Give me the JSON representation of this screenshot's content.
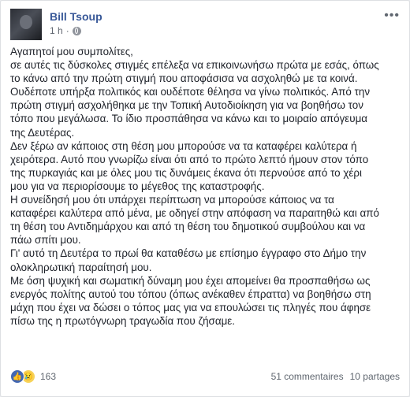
{
  "post": {
    "author": "Bill Tsoup",
    "time": "1 h",
    "separator": "·",
    "lines": [
      "Αγαπητοί μου συμπολίτες,",
      "σε αυτές τις δύσκολες στιγμές επέλεξα να επικοινωνήσω πρώτα με εσάς, όπως",
      "το κάνω από την πρώτη στιγμή που αποφάσισα να ασχοληθώ με τα κοινά.",
      "Ουδέποτε υπήρξα πολιτικός και ουδέποτε θέλησα να γίνω πολιτικός. Από την",
      "πρώτη στιγμή ασχολήθηκα με την Τοπική Αυτοδιοίκηση για να βοηθήσω τον",
      "τόπο που μεγάλωσα. Το ίδιο προσπάθησα να κάνω και το μοιραίο απόγευμα",
      "της Δευτέρας.",
      "Δεν ξέρω αν κάποιος στη θέση μου μπορούσε να τα καταφέρει καλύτερα ή",
      "χειρότερα. Αυτό που γνωρίζω είναι ότι από το πρώτο λεπτό ήμουν στον τόπο",
      "της πυρκαγιάς και με όλες μου τις δυνάμεις έκανα ότι περνούσε από το χέρι",
      "μου για να περιορίσουμε το μέγεθος της καταστροφής.",
      "Η συνείδησή μου ότι υπάρχει περίπτωση να μπορούσε κάποιος να τα",
      "καταφέρει καλύτερα από μένα, με οδηγεί στην απόφαση να παραιτηθώ και από",
      "τη θέση του Αντιδημάρχου και από τη θέση του δημοτικού συμβούλου και να",
      "πάω σπίτι μου.",
      "Γι' αυτό τη Δευτέρα το πρωί θα καταθέσω με επίσημο έγγραφο στο Δήμο την",
      "ολοκληρωτική παραίτησή μου.",
      "Με όση ψυχική και σωματική δύναμη μου έχει απομείνει θα προσπαθήσω ως",
      "ενεργός πολίτης αυτού του τόπου (όπως ανέκαθεν έπραττα) να βοηθήσω στη",
      "μάχη που έχει να δώσει ο τόπος μας για να επουλώσει τις πληγές που άφησε",
      "πίσω της η πρωτόγνωρη τραγωδία που ζήσαμε."
    ]
  },
  "icons": {
    "globe": "globe-icon",
    "more": "more-options-icon",
    "like": "like-reaction-icon",
    "sad": "sad-reaction-icon"
  },
  "footer": {
    "reaction_count": "163",
    "comments": "51 commentaires",
    "shares": "10 partages"
  },
  "colors": {
    "author": "#385898",
    "like": "#4267b2",
    "sad": "#f7d257"
  }
}
